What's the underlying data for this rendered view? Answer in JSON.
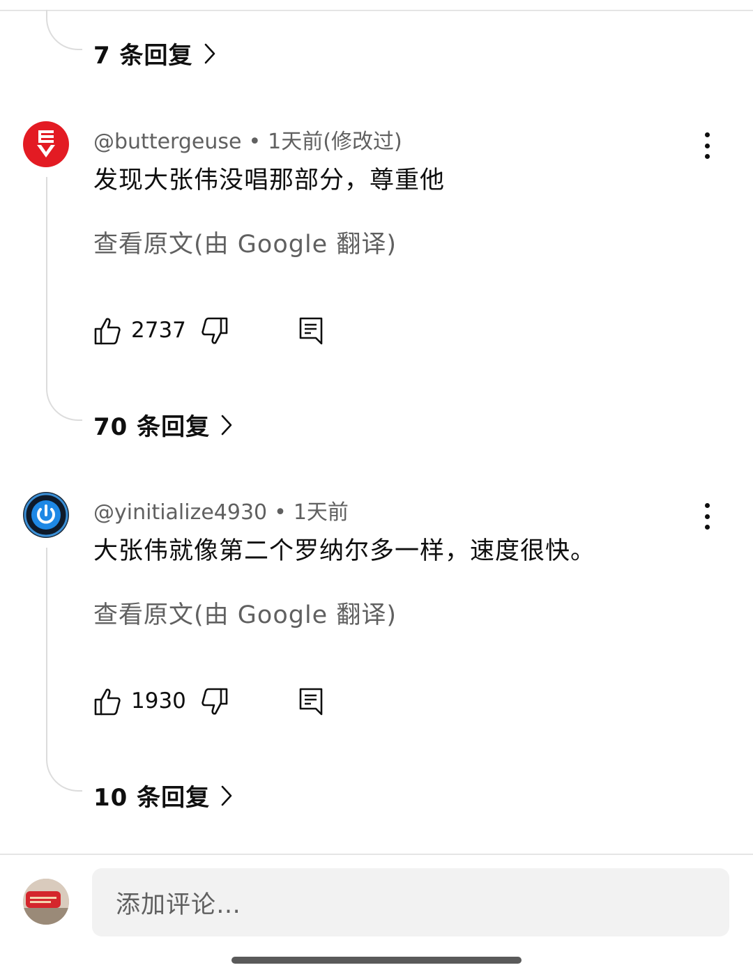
{
  "top_thread": {
    "replies_label": "7 条回复"
  },
  "comments": [
    {
      "author": "@buttergeuse",
      "time": "1天前(修改过)",
      "text": "发现大张伟没唱那部分，尊重他",
      "translate": "查看原文(由 Google 翻译)",
      "likes": "2737",
      "replies_label": "70 条回复",
      "avatar_icon": "red-circle-logo-icon",
      "avatar_color": "#e31b23"
    },
    {
      "author": "@yinitialize4930",
      "time": "1天前",
      "text": "大张伟就像第二个罗纳尔多一样，速度很快。",
      "translate": "查看原文(由 Google 翻译)",
      "likes": "1930",
      "replies_label": "10 条回复",
      "avatar_icon": "power-button-icon",
      "avatar_color": "#1b2a3a"
    }
  ],
  "composer": {
    "placeholder": "添加评论…"
  },
  "colors": {
    "text_primary": "#0f0f0f",
    "text_secondary": "#606060",
    "input_bg": "#f2f2f2",
    "thread_line": "#dcdcdc"
  }
}
